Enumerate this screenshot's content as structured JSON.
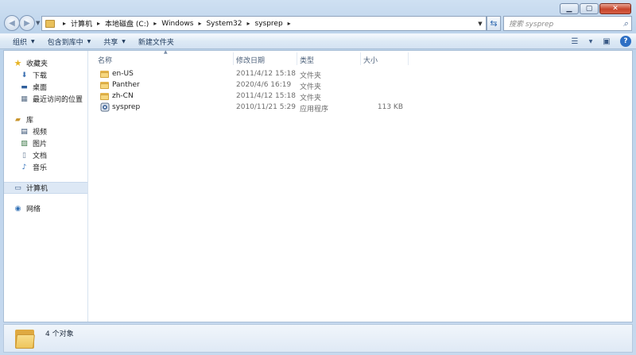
{
  "window": {
    "minimize": "▁",
    "maximize": "▢",
    "close": "✕"
  },
  "address": {
    "crumbs": [
      "计算机",
      "本地磁盘 (C:)",
      "Windows",
      "System32",
      "sysprep"
    ],
    "search_placeholder": "搜索 sysprep"
  },
  "toolbar": {
    "organize": "组织",
    "include_in_library": "包含到库中",
    "share": "共享",
    "new_folder": "新建文件夹"
  },
  "nav": {
    "favorites": "收藏夹",
    "downloads": "下载",
    "desktop": "桌面",
    "recent": "最近访问的位置",
    "libraries": "库",
    "videos": "视频",
    "pictures": "图片",
    "documents": "文档",
    "music": "音乐",
    "computer": "计算机",
    "network": "网络"
  },
  "columns": {
    "name": "名称",
    "date": "修改日期",
    "type": "类型",
    "size": "大小"
  },
  "files": [
    {
      "name": "en-US",
      "date": "2011/4/12 15:18",
      "type": "文件夹",
      "size": "",
      "icon": "folder-icon"
    },
    {
      "name": "Panther",
      "date": "2020/4/6 16:19",
      "type": "文件夹",
      "size": "",
      "icon": "folder-icon"
    },
    {
      "name": "zh-CN",
      "date": "2011/4/12 15:18",
      "type": "文件夹",
      "size": "",
      "icon": "folder-icon"
    },
    {
      "name": "sysprep",
      "date": "2010/11/21 5:29",
      "type": "应用程序",
      "size": "113 KB",
      "icon": "application-icon"
    }
  ],
  "status": {
    "count": "4 个对象"
  },
  "colors": {
    "accent": "#2d6fc4",
    "folder": "#f6d77e",
    "selection": "#dde8f5"
  }
}
